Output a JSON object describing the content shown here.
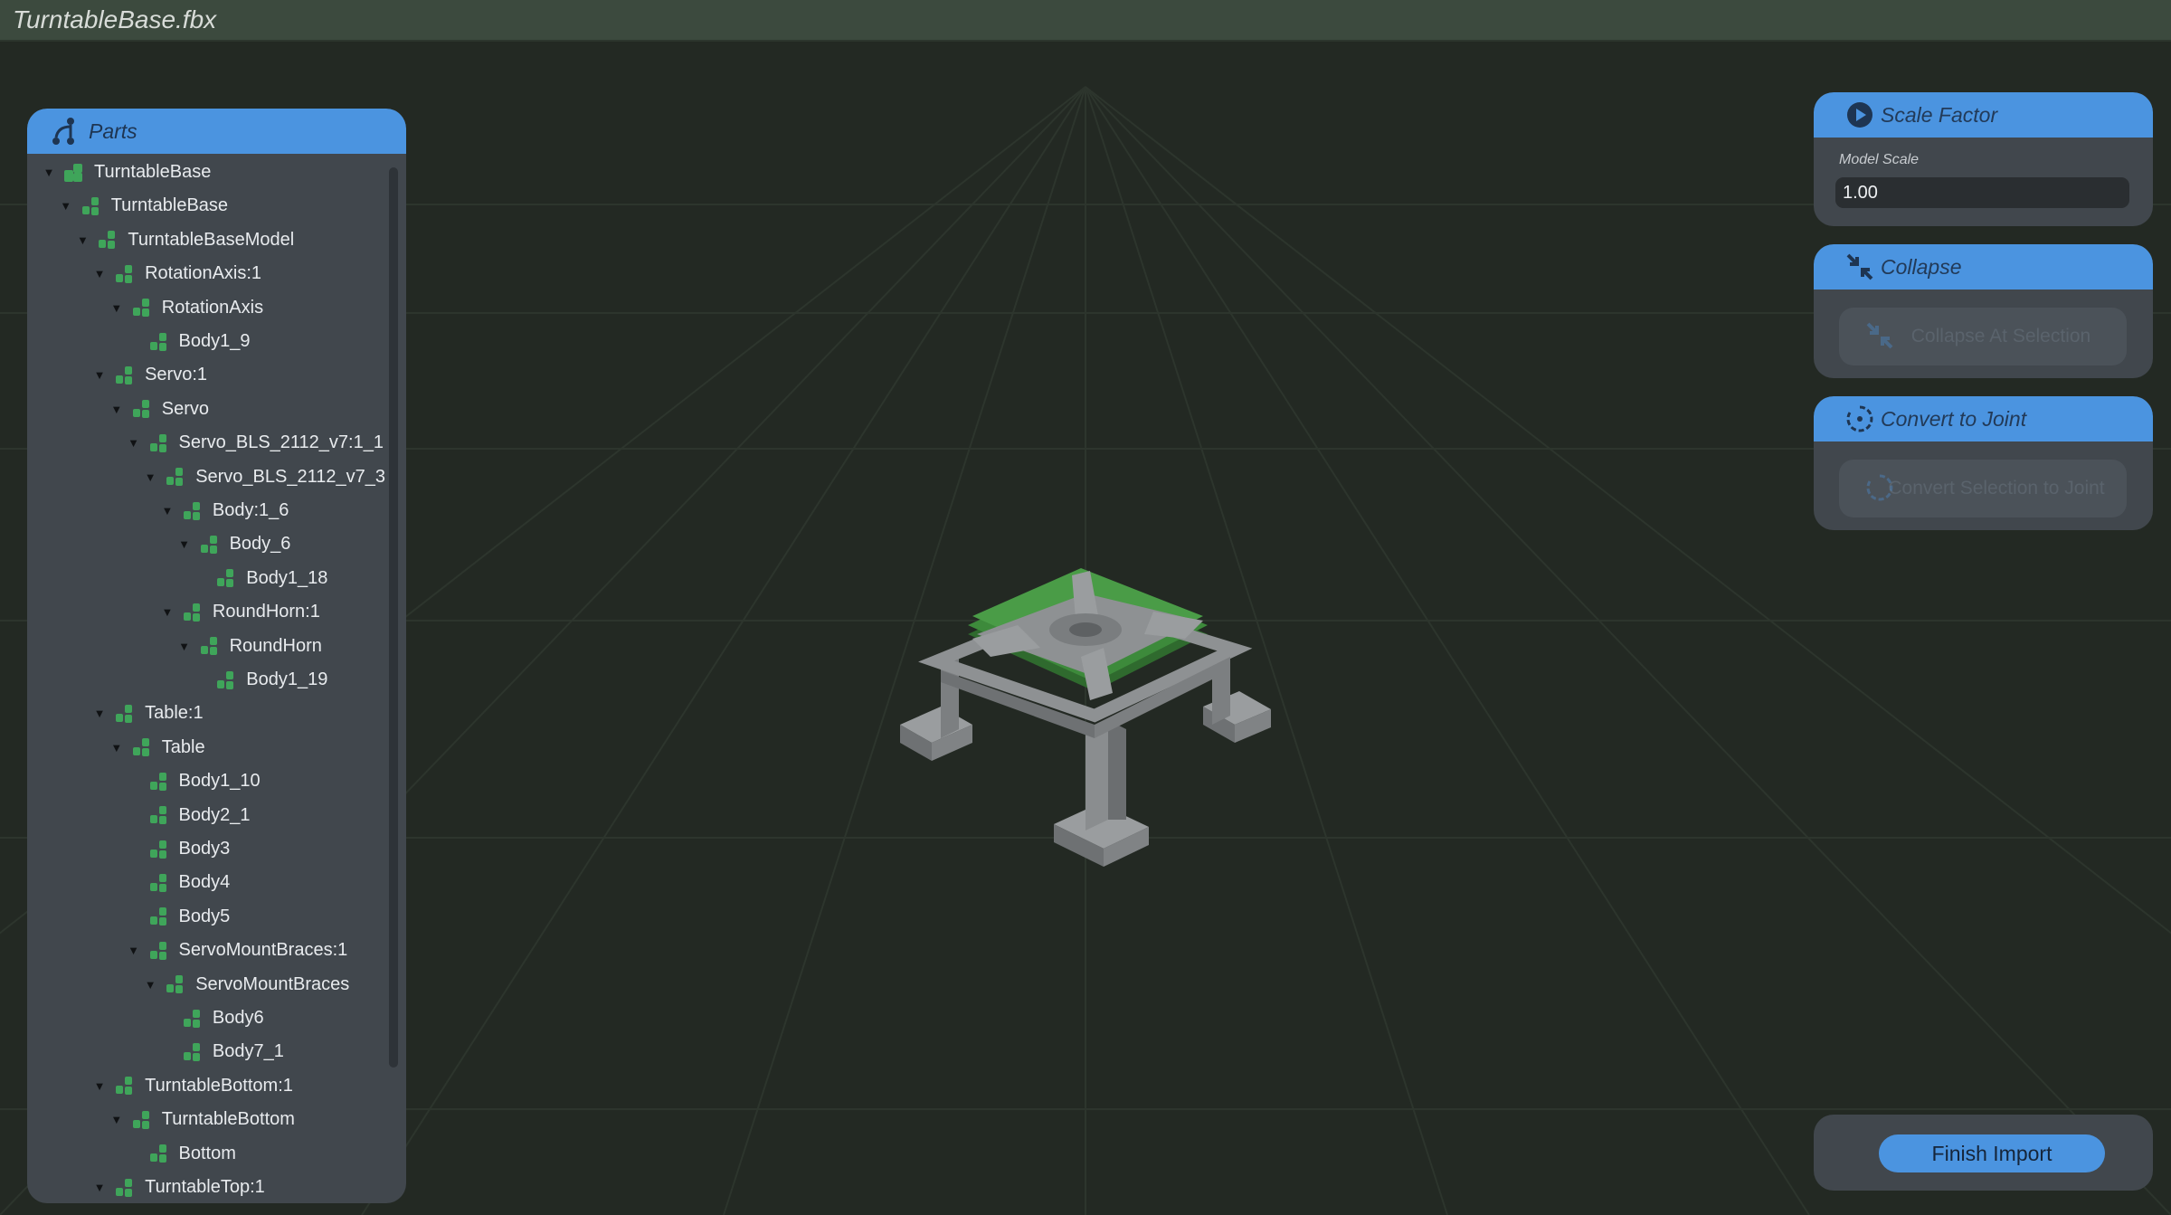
{
  "window": {
    "title": "TurntableBase.fbx"
  },
  "parts_panel": {
    "title": "Parts",
    "icon": "hierarchy-icon",
    "tree": [
      {
        "label": "TurntableBase",
        "depth": 0,
        "expanded": true,
        "icon": "root-node-icon"
      },
      {
        "label": "TurntableBase",
        "depth": 1,
        "expanded": true,
        "icon": "node-icon"
      },
      {
        "label": "TurntableBaseModel",
        "depth": 2,
        "expanded": true,
        "icon": "node-icon"
      },
      {
        "label": "RotationAxis:1",
        "depth": 3,
        "expanded": true,
        "icon": "node-icon"
      },
      {
        "label": "RotationAxis",
        "depth": 4,
        "expanded": true,
        "icon": "node-icon"
      },
      {
        "label": "Body1_9",
        "depth": 5,
        "expanded": null,
        "icon": "node-icon"
      },
      {
        "label": "Servo:1",
        "depth": 3,
        "expanded": true,
        "icon": "node-icon"
      },
      {
        "label": "Servo",
        "depth": 4,
        "expanded": true,
        "icon": "node-icon"
      },
      {
        "label": "Servo_BLS_2112_v7:1_1",
        "depth": 5,
        "expanded": true,
        "icon": "node-icon"
      },
      {
        "label": "Servo_BLS_2112_v7_3",
        "depth": 6,
        "expanded": true,
        "icon": "node-icon"
      },
      {
        "label": "Body:1_6",
        "depth": 7,
        "expanded": true,
        "icon": "node-icon"
      },
      {
        "label": "Body_6",
        "depth": 8,
        "expanded": true,
        "icon": "node-icon"
      },
      {
        "label": "Body1_18",
        "depth": 9,
        "expanded": null,
        "icon": "node-icon"
      },
      {
        "label": "RoundHorn:1",
        "depth": 7,
        "expanded": true,
        "icon": "node-icon"
      },
      {
        "label": "RoundHorn",
        "depth": 8,
        "expanded": true,
        "icon": "node-icon"
      },
      {
        "label": "Body1_19",
        "depth": 9,
        "expanded": null,
        "icon": "node-icon"
      },
      {
        "label": "Table:1",
        "depth": 3,
        "expanded": true,
        "icon": "node-icon"
      },
      {
        "label": "Table",
        "depth": 4,
        "expanded": true,
        "icon": "node-icon"
      },
      {
        "label": "Body1_10",
        "depth": 5,
        "expanded": null,
        "icon": "node-icon"
      },
      {
        "label": "Body2_1",
        "depth": 5,
        "expanded": null,
        "icon": "node-icon"
      },
      {
        "label": "Body3",
        "depth": 5,
        "expanded": null,
        "icon": "node-icon"
      },
      {
        "label": "Body4",
        "depth": 5,
        "expanded": null,
        "icon": "node-icon"
      },
      {
        "label": "Body5",
        "depth": 5,
        "expanded": null,
        "icon": "node-icon"
      },
      {
        "label": "ServoMountBraces:1",
        "depth": 5,
        "expanded": true,
        "icon": "node-icon"
      },
      {
        "label": "ServoMountBraces",
        "depth": 6,
        "expanded": true,
        "icon": "node-icon"
      },
      {
        "label": "Body6",
        "depth": 7,
        "expanded": null,
        "icon": "node-icon"
      },
      {
        "label": "Body7_1",
        "depth": 7,
        "expanded": null,
        "icon": "node-icon"
      },
      {
        "label": "TurntableBottom:1",
        "depth": 3,
        "expanded": true,
        "icon": "node-icon"
      },
      {
        "label": "TurntableBottom",
        "depth": 4,
        "expanded": true,
        "icon": "node-icon"
      },
      {
        "label": "Bottom",
        "depth": 5,
        "expanded": null,
        "icon": "node-icon"
      },
      {
        "label": "TurntableTop:1",
        "depth": 3,
        "expanded": true,
        "icon": "node-icon"
      }
    ]
  },
  "scale_panel": {
    "title": "Scale Factor",
    "icon": "play-circle-icon",
    "field_label": "Model Scale",
    "field_value": "1.00"
  },
  "collapse_panel": {
    "title": "Collapse",
    "icon": "collapse-arrows-icon",
    "button_label": "Collapse At Selection",
    "button_enabled": false
  },
  "joint_panel": {
    "title": "Convert to Joint",
    "icon": "joint-rotate-icon",
    "button_label": "Convert Selection to Joint",
    "button_enabled": false
  },
  "finish": {
    "label": "Finish Import"
  },
  "colors": {
    "accent": "#4b94e0",
    "panel": "#41474d",
    "background": "#232923",
    "title_bar": "#3c4a3e",
    "node_icon": "#3fa55a",
    "model_green": "#3d8a3b",
    "model_grey": "#8a8d8f"
  }
}
